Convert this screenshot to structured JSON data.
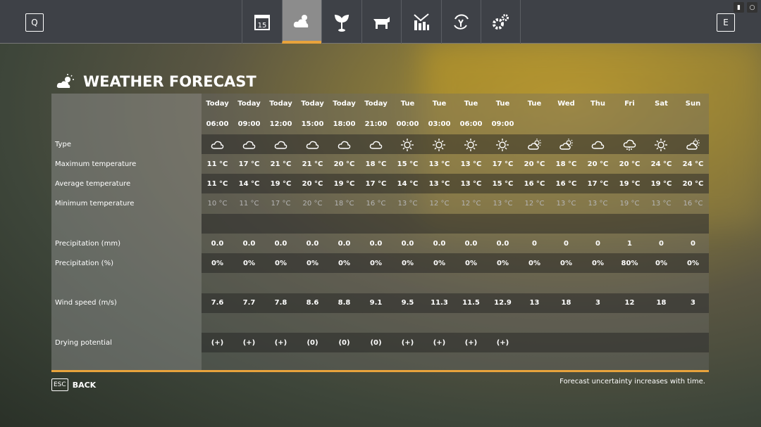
{
  "topbar": {
    "left_key": "Q",
    "right_key": "E",
    "tabs": [
      {
        "icon": "calendar-icon",
        "label": "15"
      },
      {
        "icon": "weather-icon",
        "active": true
      },
      {
        "icon": "sprout-icon"
      },
      {
        "icon": "cow-icon"
      },
      {
        "icon": "stats-icon"
      },
      {
        "icon": "cycle-icon"
      },
      {
        "icon": "gears-icon"
      }
    ]
  },
  "title": "WEATHER FORECAST",
  "columns": [
    {
      "day": "Today",
      "time": "06:00",
      "type": "cloudy",
      "max": "11 °C",
      "avg": "11 °C",
      "min": "10 °C",
      "precip_mm": "0.0",
      "precip_pct": "0%",
      "wind": "7.6",
      "drying": "(+)"
    },
    {
      "day": "Today",
      "time": "09:00",
      "type": "cloudy",
      "max": "17 °C",
      "avg": "14 °C",
      "min": "11 °C",
      "precip_mm": "0.0",
      "precip_pct": "0%",
      "wind": "7.7",
      "drying": "(+)"
    },
    {
      "day": "Today",
      "time": "12:00",
      "type": "cloudy",
      "max": "21 °C",
      "avg": "19 °C",
      "min": "17 °C",
      "precip_mm": "0.0",
      "precip_pct": "0%",
      "wind": "7.8",
      "drying": "(+)"
    },
    {
      "day": "Today",
      "time": "15:00",
      "type": "cloudy",
      "max": "21 °C",
      "avg": "20 °C",
      "min": "20 °C",
      "precip_mm": "0.0",
      "precip_pct": "0%",
      "wind": "8.6",
      "drying": "(0)"
    },
    {
      "day": "Today",
      "time": "18:00",
      "type": "cloudy",
      "max": "20 °C",
      "avg": "19 °C",
      "min": "18 °C",
      "precip_mm": "0.0",
      "precip_pct": "0%",
      "wind": "8.8",
      "drying": "(0)"
    },
    {
      "day": "Today",
      "time": "21:00",
      "type": "cloudy",
      "max": "18 °C",
      "avg": "17 °C",
      "min": "16 °C",
      "precip_mm": "0.0",
      "precip_pct": "0%",
      "wind": "9.1",
      "drying": "(0)"
    },
    {
      "day": "Tue",
      "time": "00:00",
      "type": "sunny",
      "max": "15 °C",
      "avg": "14 °C",
      "min": "13 °C",
      "precip_mm": "0.0",
      "precip_pct": "0%",
      "wind": "9.5",
      "drying": "(+)"
    },
    {
      "day": "Tue",
      "time": "03:00",
      "type": "sunny",
      "max": "13 °C",
      "avg": "13 °C",
      "min": "12 °C",
      "precip_mm": "0.0",
      "precip_pct": "0%",
      "wind": "11.3",
      "drying": "(+)"
    },
    {
      "day": "Tue",
      "time": "06:00",
      "type": "sunny",
      "max": "13 °C",
      "avg": "13 °C",
      "min": "12 °C",
      "precip_mm": "0.0",
      "precip_pct": "0%",
      "wind": "11.5",
      "drying": "(+)"
    },
    {
      "day": "Tue",
      "time": "09:00",
      "type": "sunny",
      "max": "17 °C",
      "avg": "15 °C",
      "min": "13 °C",
      "precip_mm": "0.0",
      "precip_pct": "0%",
      "wind": "12.9",
      "drying": "(+)"
    },
    {
      "day": "Tue",
      "time": "",
      "type": "partly-cloudy",
      "max": "20 °C",
      "avg": "16 °C",
      "min": "12 °C",
      "precip_mm": "0",
      "precip_pct": "0%",
      "wind": "13",
      "drying": ""
    },
    {
      "day": "Wed",
      "time": "",
      "type": "partly-cloudy",
      "max": "18 °C",
      "avg": "16 °C",
      "min": "13 °C",
      "precip_mm": "0",
      "precip_pct": "0%",
      "wind": "18",
      "drying": ""
    },
    {
      "day": "Thu",
      "time": "",
      "type": "cloudy",
      "max": "20 °C",
      "avg": "17 °C",
      "min": "13 °C",
      "precip_mm": "0",
      "precip_pct": "0%",
      "wind": "3",
      "drying": ""
    },
    {
      "day": "Fri",
      "time": "",
      "type": "rain",
      "max": "20 °C",
      "avg": "19 °C",
      "min": "19 °C",
      "precip_mm": "1",
      "precip_pct": "80%",
      "wind": "12",
      "drying": ""
    },
    {
      "day": "Sat",
      "time": "",
      "type": "sunny",
      "max": "24 °C",
      "avg": "19 °C",
      "min": "13 °C",
      "precip_mm": "0",
      "precip_pct": "0%",
      "wind": "18",
      "drying": ""
    },
    {
      "day": "Sun",
      "time": "",
      "type": "partly-cloudy",
      "max": "24 °C",
      "avg": "20 °C",
      "min": "16 °C",
      "precip_mm": "0",
      "precip_pct": "0%",
      "wind": "3",
      "drying": ""
    }
  ],
  "rows": [
    {
      "key": "day",
      "label": ""
    },
    {
      "key": "time",
      "label": ""
    },
    {
      "key": "type",
      "label": "Type"
    },
    {
      "key": "max",
      "label": "Maximum temperature"
    },
    {
      "key": "avg",
      "label": "Average temperature"
    },
    {
      "key": "min",
      "label": "Minimum temperature"
    },
    {
      "key": "",
      "label": ""
    },
    {
      "key": "precip_mm",
      "label": "Precipitation (mm)"
    },
    {
      "key": "precip_pct",
      "label": "Precipitation (%)"
    },
    {
      "key": "",
      "label": ""
    },
    {
      "key": "wind",
      "label": "Wind speed (m/s)"
    },
    {
      "key": "",
      "label": ""
    },
    {
      "key": "drying",
      "label": "Drying potential"
    },
    {
      "key": "",
      "label": ""
    }
  ],
  "footer": {
    "esc_key": "ESC",
    "back_label": "BACK",
    "note": "Forecast uncertainty increases with time."
  },
  "colors": {
    "accent": "#e8a33c",
    "topbar": "#3e4147"
  }
}
